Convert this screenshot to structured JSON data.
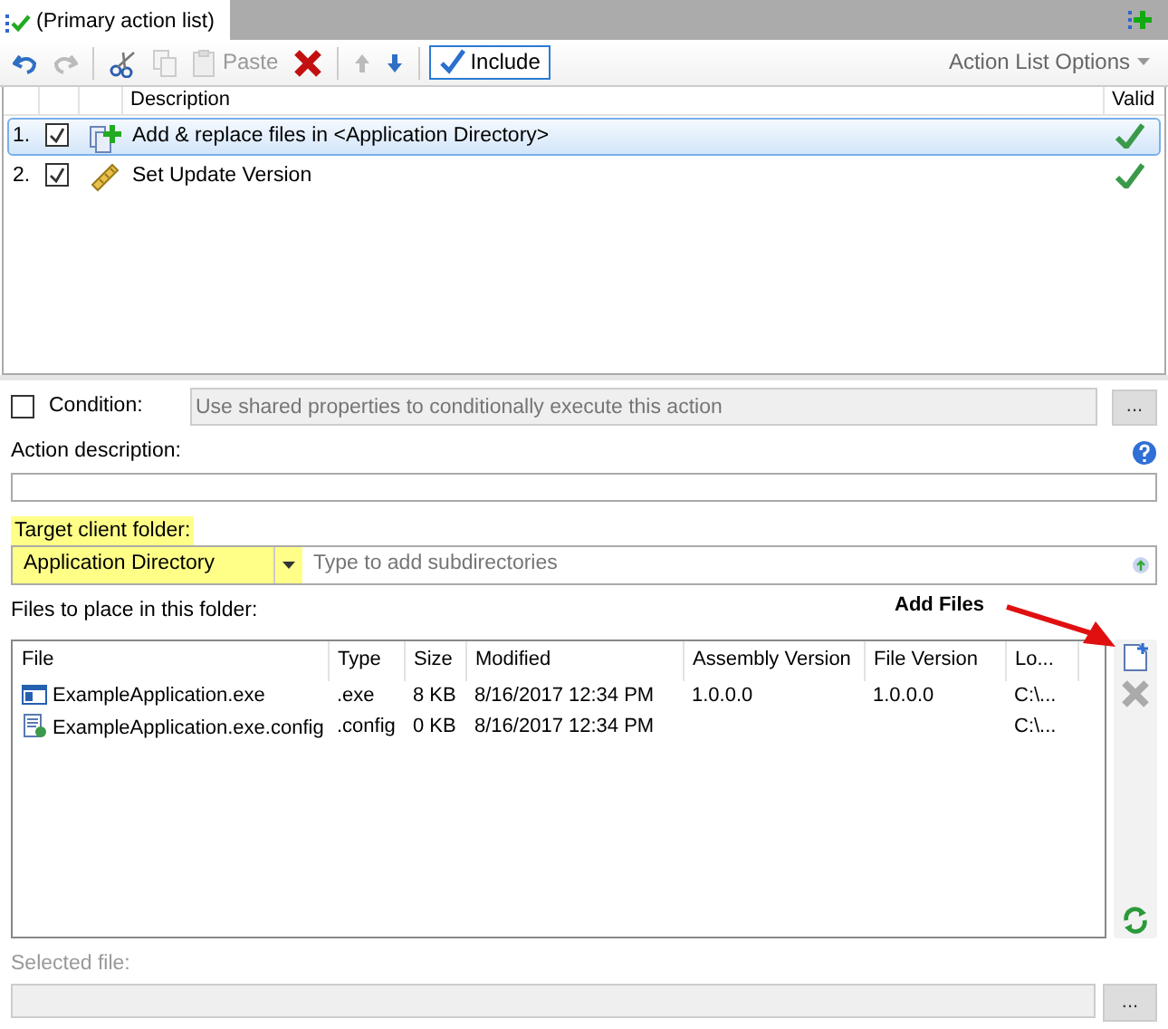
{
  "tab": {
    "title": "(Primary action list)"
  },
  "toolbar": [
    {
      "kind": "undo",
      "disabled": false
    },
    {
      "kind": "redo",
      "disabled": true
    },
    {
      "kind": "cut",
      "disabled": false
    },
    {
      "kind": "copy",
      "disabled": true
    },
    {
      "kind": "paste",
      "label": "Paste",
      "disabled": true
    },
    {
      "kind": "delete",
      "disabled": false
    },
    {
      "kind": "up",
      "disabled": true
    },
    {
      "kind": "down",
      "disabled": false
    },
    {
      "kind": "include",
      "label": "Include",
      "on": true
    }
  ],
  "options_menu": "Action List Options",
  "actions": {
    "columns": [
      "Description",
      "Valid"
    ],
    "rows": [
      {
        "number": "1.",
        "checked": true,
        "kind": "add_files",
        "description": "Add & replace files in <Application Directory>",
        "valid": true,
        "selected": true
      },
      {
        "number": "2.",
        "checked": true,
        "kind": "version",
        "description": "Set Update Version",
        "valid": true,
        "selected": false
      }
    ]
  },
  "condition": {
    "checked": false,
    "label": "Condition:",
    "placeholder": "Use shared properties to conditionally execute this action",
    "button": "..."
  },
  "action_description": {
    "label": "Action description:"
  },
  "target_folder": {
    "label": "Target client folder:",
    "value": "Application Directory",
    "highlighted": true,
    "placeholder": "Type to add subdirectories"
  },
  "files": {
    "label": "Files to place in this folder:",
    "columns": [
      "File",
      "Type",
      "Size",
      "Modified",
      "Assembly Version",
      "File Version",
      "Lo..."
    ],
    "rows": [
      {
        "kind": "exe",
        "cells": [
          "ExampleApplication.exe",
          ".exe",
          "8 KB",
          "8/16/2017 12:34 PM",
          "1.0.0.0",
          "1.0.0.0",
          "C:\\..."
        ]
      },
      {
        "kind": "config",
        "cells": [
          "ExampleApplication.exe.config",
          ".config",
          "0 KB",
          "8/16/2017 12:34 PM",
          "",
          "",
          "C:\\..."
        ]
      }
    ],
    "annotation": "Add Files"
  },
  "selected_file": {
    "label": "Selected file:",
    "disabled": true,
    "button": "..."
  }
}
